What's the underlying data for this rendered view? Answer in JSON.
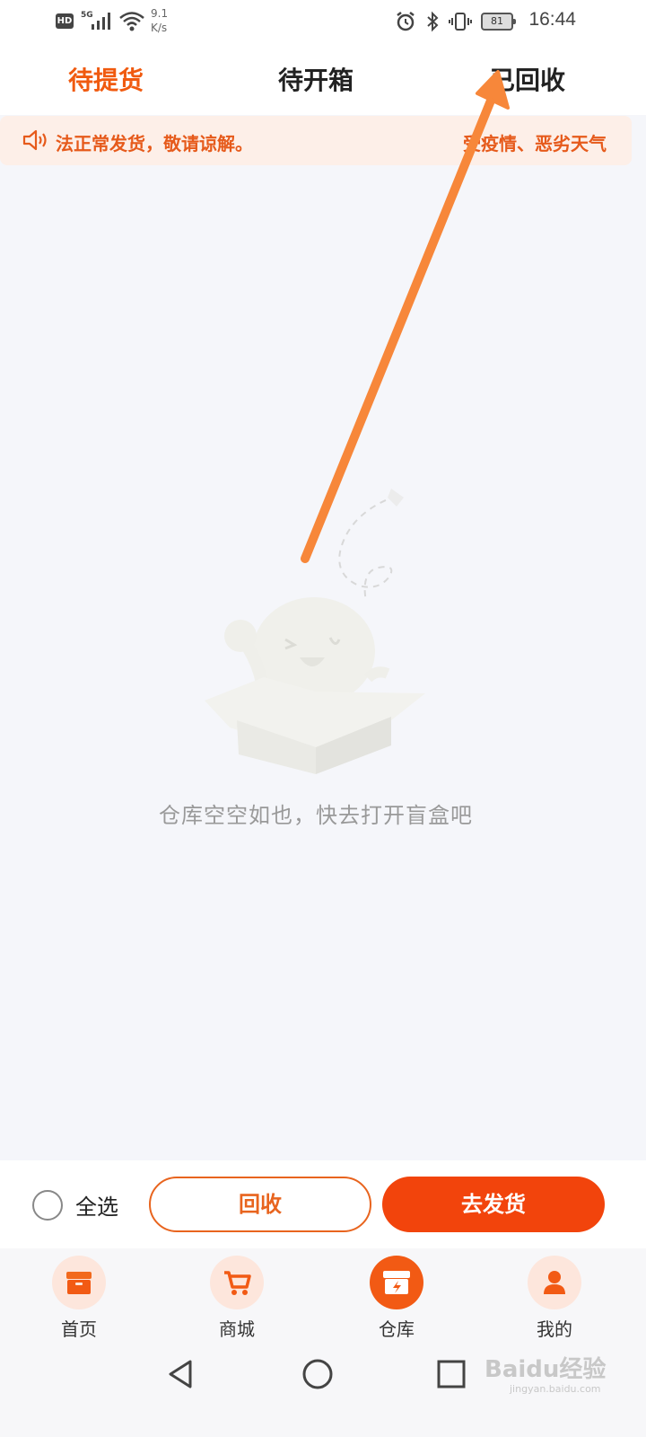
{
  "status_bar": {
    "hd": "HD",
    "network": "5G",
    "speed_value": "9.1",
    "speed_unit": "K/s",
    "battery": "81",
    "time": "16:44"
  },
  "tabs": [
    {
      "label": "待提货",
      "active": true
    },
    {
      "label": "待开箱",
      "active": false
    },
    {
      "label": "已回收",
      "active": false
    }
  ],
  "notice": {
    "icon": "speaker-icon",
    "text": "法正常发货，敬请谅解。",
    "text_next": "受疫情、恶劣天气"
  },
  "empty_state": {
    "message": "仓库空空如也，快去打开盲盒吧"
  },
  "action_bar": {
    "select_all_label": "全选",
    "recycle_label": "回收",
    "ship_label": "去发货"
  },
  "bottom_nav": [
    {
      "label": "首页",
      "icon": "home-box-icon",
      "active": false
    },
    {
      "label": "商城",
      "icon": "cart-icon",
      "active": false
    },
    {
      "label": "仓库",
      "icon": "warehouse-box-icon",
      "active": true
    },
    {
      "label": "我的",
      "icon": "user-icon",
      "active": false
    }
  ],
  "watermark": {
    "text": "Baidu经验",
    "sub": "jingyan.baidu.com"
  },
  "colors": {
    "accent": "#f05a0f",
    "button_primary": "#f2440c",
    "notice_bg": "#fdefe8",
    "annotation_arrow": "#f7873a"
  }
}
